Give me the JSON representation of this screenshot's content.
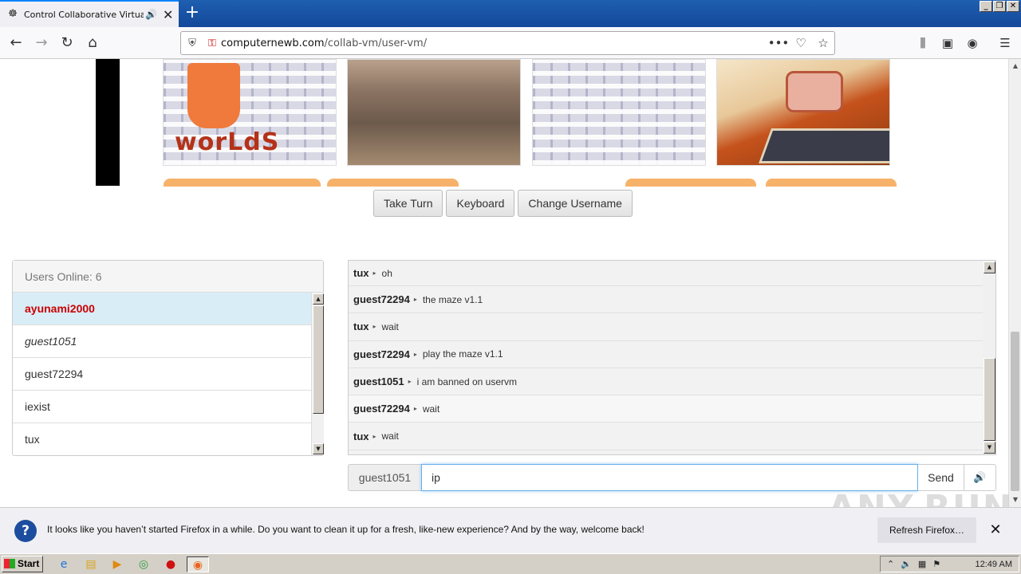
{
  "browser": {
    "tab_title": "Control Collaborative Virtual M",
    "url_host": "computernewb.com",
    "url_path": "/collab-vm/user-vm/"
  },
  "vm_controls": {
    "take_turn": "Take Turn",
    "keyboard": "Keyboard",
    "change_username": "Change Username"
  },
  "thumbnails": {
    "logo_text": "worLdS"
  },
  "users": {
    "header": "Users Online: 6",
    "list": [
      {
        "name": "ayunami2000"
      },
      {
        "name": "guest1051"
      },
      {
        "name": "guest72294"
      },
      {
        "name": "iexist"
      },
      {
        "name": "tux"
      }
    ]
  },
  "chat": {
    "messages": [
      {
        "user": "tux",
        "text": "oh"
      },
      {
        "user": "guest72294",
        "text": "the maze v1.1"
      },
      {
        "user": "tux",
        "text": "wait"
      },
      {
        "user": "guest72294",
        "text": "play the maze v1.1"
      },
      {
        "user": "guest1051",
        "text": "i am banned on uservm"
      },
      {
        "user": "guest72294",
        "text": "wait"
      },
      {
        "user": "tux",
        "text": "wait"
      }
    ],
    "username": "guest1051",
    "input_value": "ip",
    "send_label": "Send"
  },
  "notification": {
    "text": "It looks like you haven’t started Firefox in a while. Do you want to clean it up for a fresh, like-new experience? And by the way, welcome back!",
    "button": "Refresh Firefox…"
  },
  "watermark": "ANY.RUN",
  "taskbar": {
    "start": "Start",
    "clock": "12:49 AM"
  }
}
